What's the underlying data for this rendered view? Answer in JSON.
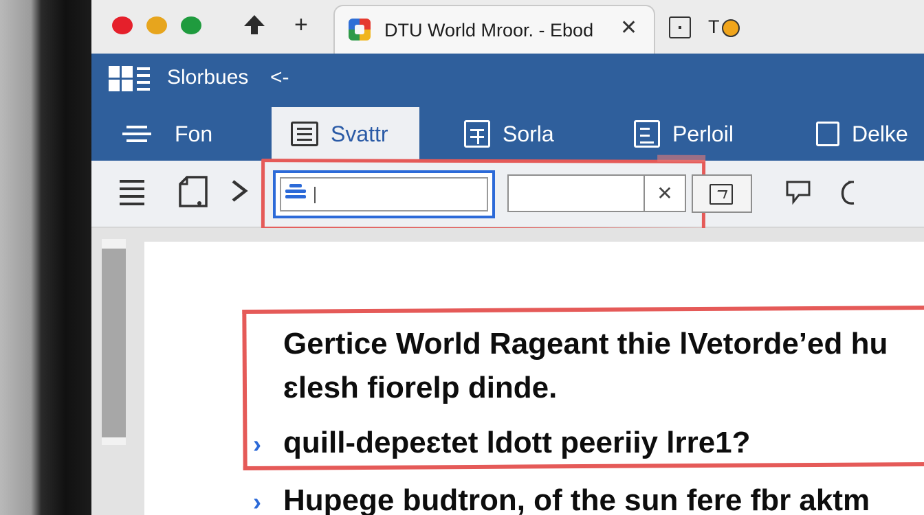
{
  "browser": {
    "tab": {
      "title": "DTU World Mroor. - Ebod"
    },
    "close_glyph": "✕",
    "nav": {
      "up_glyph": "🡅",
      "add_glyph": "+"
    },
    "extra_label": "T"
  },
  "app": {
    "title": "Slorbues",
    "title_arrow": "<-"
  },
  "ribbon": {
    "tabs": [
      {
        "label": "Fon",
        "icon": "menu-lines-icon",
        "active": false
      },
      {
        "label": "Svattr",
        "icon": "layout-box-icon",
        "active": true
      },
      {
        "label": "Sorla",
        "icon": "calendar-grid-icon",
        "active": false
      },
      {
        "label": "Perloil",
        "icon": "panel-split-icon",
        "active": false
      },
      {
        "label": "Delke",
        "icon": "square-icon",
        "active": false
      }
    ]
  },
  "toolbar": {
    "menu_glyph": "☰",
    "forward_glyph": "›",
    "search": {
      "value": "",
      "placeholder": ""
    },
    "filter": {
      "value": "",
      "placeholder": "",
      "clear_glyph": "✕"
    },
    "icons": [
      "menu-icon",
      "document-icon",
      "chevron-right-icon",
      "external-link-icon",
      "comment-icon",
      "phone-icon"
    ]
  },
  "document": {
    "lines": [
      "Gertice World Rageant thie lVetorde’ed hu",
      "ɛlesh fiorelp dinde.",
      "quill-depeɛtet ldott peeriiy lrre1?",
      "Hupege budtron, of the sun  fere fbr aktm"
    ],
    "chevron": "›"
  },
  "colors": {
    "accent_blue": "#2f5f9c",
    "highlight_red": "#e55a58",
    "focus_blue": "#2c6ad8"
  }
}
